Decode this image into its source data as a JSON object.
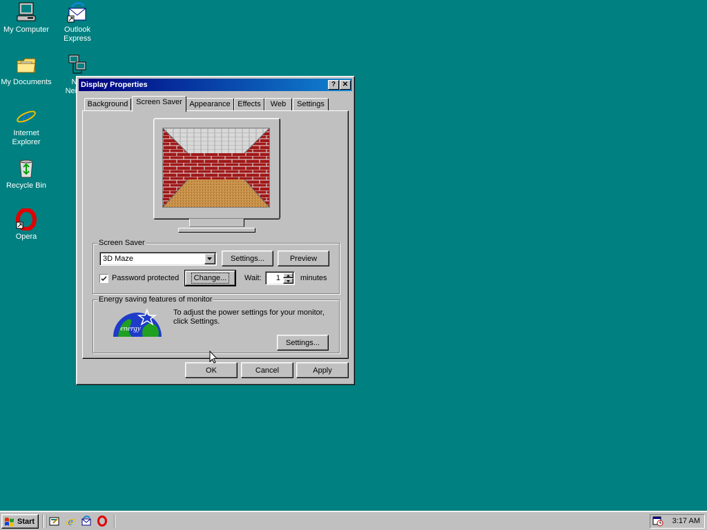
{
  "desktop": {
    "icons": [
      {
        "label_lines": [
          "My Computer"
        ]
      },
      {
        "label_lines": [
          "Outlook",
          "Express"
        ]
      },
      {
        "label_lines": [
          "My Documents"
        ]
      },
      {
        "label_lines": [
          "Net",
          "Neighb"
        ]
      },
      {
        "label_lines": [
          "Internet",
          "Explorer"
        ]
      },
      {
        "label_lines": [
          "Recycle Bin"
        ]
      },
      {
        "label_lines": [
          "Opera"
        ]
      }
    ]
  },
  "window": {
    "title": "Display Properties",
    "help_label": "?",
    "close_label": "✕",
    "tabs": [
      {
        "label": "Background"
      },
      {
        "label": "Screen Saver"
      },
      {
        "label": "Appearance"
      },
      {
        "label": "Effects"
      },
      {
        "label": "Web"
      },
      {
        "label": "Settings"
      }
    ],
    "active_tab": "Screen Saver",
    "screen_saver": {
      "group_label": "Screen Saver",
      "selected": "3D Maze",
      "settings_label": "Settings...",
      "preview_label": "Preview",
      "password_label": "Password protected",
      "password_checked": true,
      "change_label": "Change...",
      "wait_label": "Wait:",
      "wait_value": "1",
      "minutes_label": "minutes"
    },
    "energy": {
      "group_label": "Energy saving features of monitor",
      "text_line1": "To adjust the power settings for your monitor,",
      "text_line2": "click Settings.",
      "settings_label": "Settings...",
      "logo_text": "energy"
    },
    "buttons": {
      "ok": "OK",
      "cancel": "Cancel",
      "apply": "Apply"
    }
  },
  "taskbar": {
    "start_label": "Start",
    "quick_launch": [
      "show-desktop-icon",
      "internet-explorer-icon",
      "outlook-express-icon",
      "opera-icon"
    ],
    "clock": "3:17 AM"
  },
  "colors": {
    "desktop": "#008080",
    "titlebar_start": "#000080",
    "titlebar_end": "#1084d0",
    "face": "#c0c0c0"
  }
}
